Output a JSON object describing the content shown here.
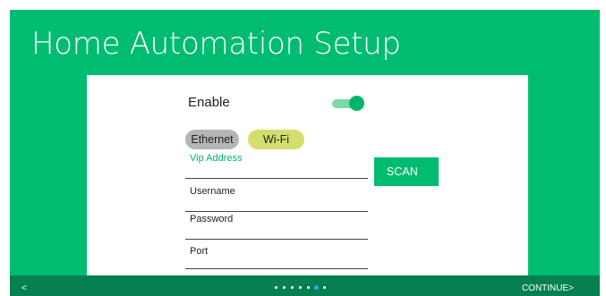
{
  "header": {
    "title": "Home Automation Setup"
  },
  "form": {
    "enable_label": "Enable",
    "enable_toggle_on": true,
    "connection_options": [
      "Ethernet",
      "Wi-Fi"
    ],
    "selected_connection": "Wi-Fi",
    "fields": {
      "vip_address": "Vip Address",
      "username": "Username",
      "password": "Password",
      "port": "Port"
    },
    "scan_label": "SCAN"
  },
  "footer": {
    "back_label": "<",
    "continue_label": "CONTINUE>",
    "page_count": 7,
    "current_page": 6
  },
  "colors": {
    "brand_green": "#00bc71",
    "footer_green": "#068050",
    "wifi_chip": "#d4de6d",
    "ethernet_chip": "#b5b5b5",
    "active_dot": "#2aa8ff"
  }
}
